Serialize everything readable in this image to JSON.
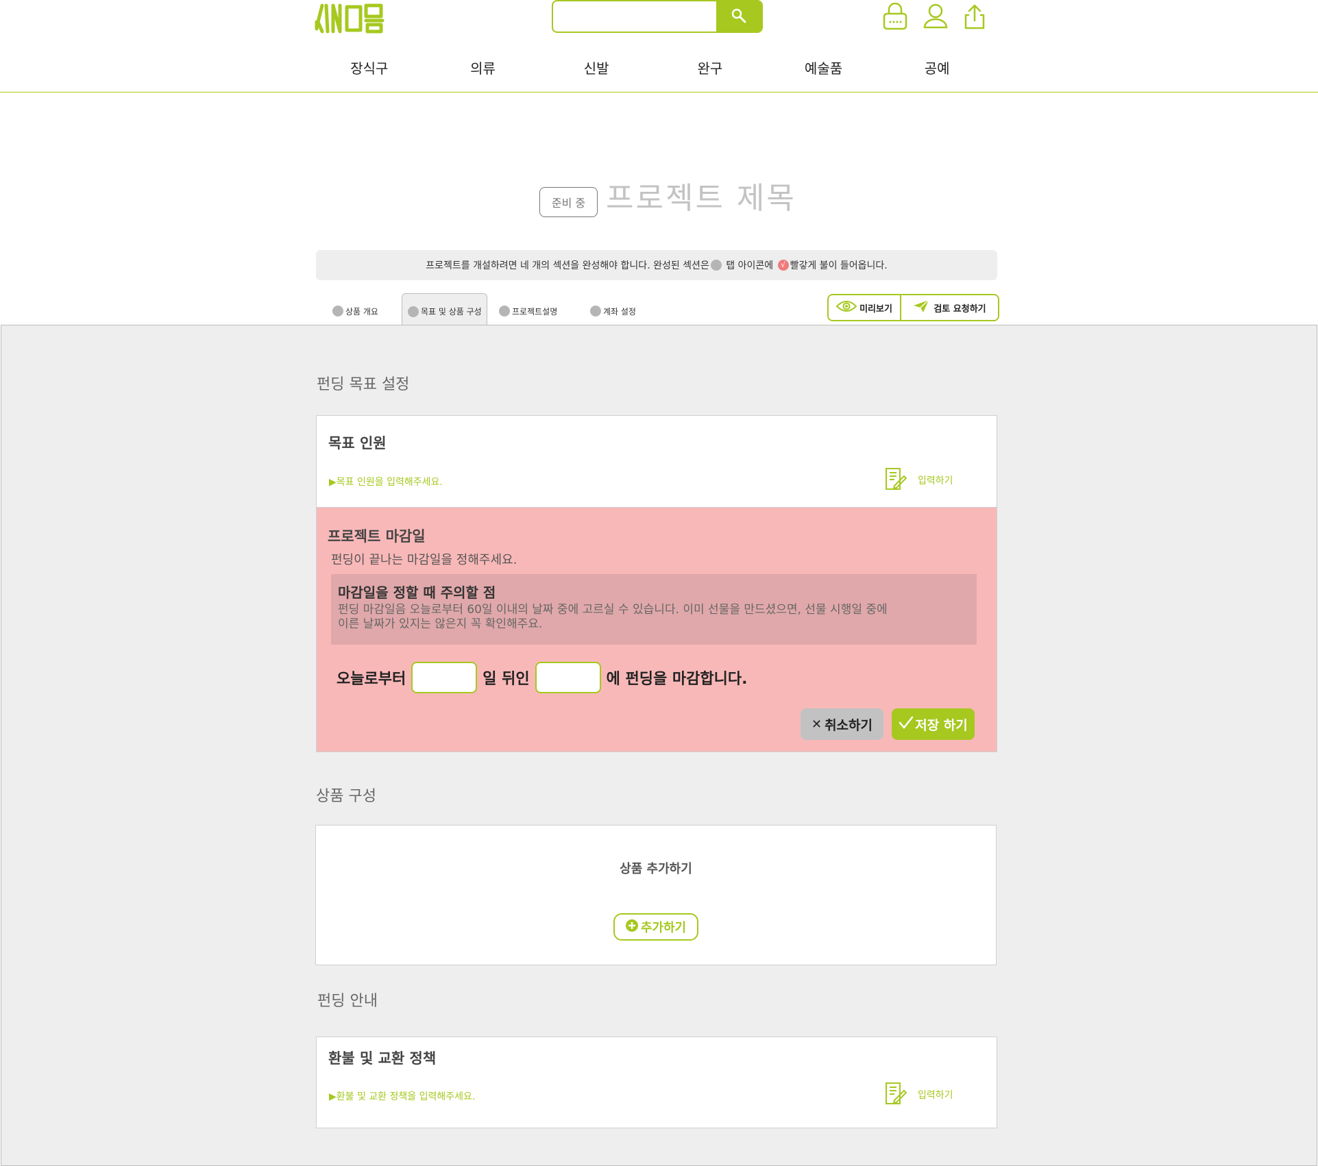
{
  "header": {
    "logo_text": "새마음",
    "search": {
      "value": "",
      "placeholder": ""
    },
    "icons": [
      "lock-icon",
      "user-icon",
      "share-icon"
    ],
    "nav": [
      "장식구",
      "의류",
      "신발",
      "완구",
      "예술품",
      "공예"
    ]
  },
  "project": {
    "status_badge": "준비 중",
    "title": "프로젝트 제목",
    "notice_part1": "프로젝트를 개설하려면 네 개의 섹션을 완성해야 합니다. 완성된 섹션은",
    "notice_part2": " 탭 아이콘에 ",
    "notice_check": "√",
    "notice_part3": "빨갛게 불이 들어옵니다."
  },
  "tabs": [
    {
      "label": "상품 개요",
      "active": false
    },
    {
      "label": "목표 및 상품 구성",
      "active": true
    },
    {
      "label": "프로젝트설명",
      "active": false
    },
    {
      "label": "계좌 설정",
      "active": false
    }
  ],
  "actions": {
    "preview": "미리보기",
    "review": "검토 요청하기"
  },
  "funding_goal": {
    "section_title": "펀딩 목표 설정",
    "target": {
      "title": "목표 인원",
      "hint": "▶목표 인원을 입력해주세요.",
      "edit": "입력하기"
    },
    "deadline": {
      "title": "프로젝트 마감일",
      "desc": "펀딩이 끝나는 마감일을 정해주세요.",
      "caution_title": "마감일을 정할 때 주의할 점",
      "caution_line1": "펀딩 마감일음 오늘로부터 60일 이내의 날짜 중에 고르실 수 있습니다. 이미 선물을 만드셨으면, 선물 시행일 중에",
      "caution_line2": "이른 날짜가 있지는 않은지 꼭 확인해주요.",
      "sentence_start": "오늘로부터",
      "sentence_mid": "일 뒤인",
      "sentence_end": "에 펀딩을 마감합니다.",
      "days_value": "",
      "date_value": "",
      "cancel": "취소하기",
      "save": "저장 하기"
    }
  },
  "product_config": {
    "section_title": "상품 구성",
    "add_title": "상품 추가하기",
    "add_button": "추가하기"
  },
  "funding_info": {
    "section_title": "펀딩 안내",
    "refund": {
      "title": "환불 및 교환 정책",
      "hint": "▶환불 및 교환 정책을 입력해주세요.",
      "edit": "입력하기"
    }
  },
  "colors": {
    "accent": "#a6c81f",
    "pink": "#f9b8b8",
    "panel": "#eeeeee"
  }
}
